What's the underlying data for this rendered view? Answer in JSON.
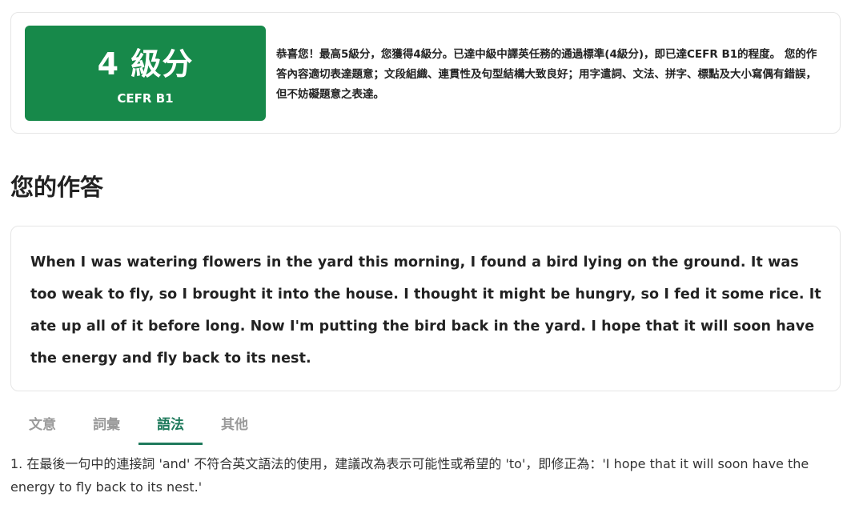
{
  "score": {
    "level_label": "4 級分",
    "cefr_label": "CEFR B1",
    "description": "恭喜您！最高5級分，您獲得4級分。已達中級中譯英任務的通過標準(4級分)，即已達CEFR B1的程度。 您的作答內容適切表達題意；文段組織、連貫性及句型結構大致良好；用字遣詞、文法、拼字、標點及大小寫偶有錯誤，但不妨礙題意之表達。"
  },
  "answer_section": {
    "heading": "您的作答",
    "text": "When I was watering flowers in the yard this morning, I found a bird lying on the ground. It was too weak to fly, so I brought it into the house. I thought it might be hungry, so I fed it some rice. It ate up all of it before long. Now I'm putting the bird back in the yard. I hope that it will soon have the energy and fly back to its nest."
  },
  "tabs": [
    {
      "label": "文意",
      "active": false
    },
    {
      "label": "詞彙",
      "active": false
    },
    {
      "label": "語法",
      "active": true
    },
    {
      "label": "其他",
      "active": false
    }
  ],
  "feedback": {
    "text": "1. 在最後一句中的連接詞 'and' 不符合英文語法的使用，建議改為表示可能性或希望的 'to'，即修正為：'I hope that it will soon have the energy to fly back to its nest.'"
  },
  "colors": {
    "score_bg": "#17894a",
    "tab_active": "#1f7a5c",
    "tab_inactive": "#9a9a9a"
  }
}
